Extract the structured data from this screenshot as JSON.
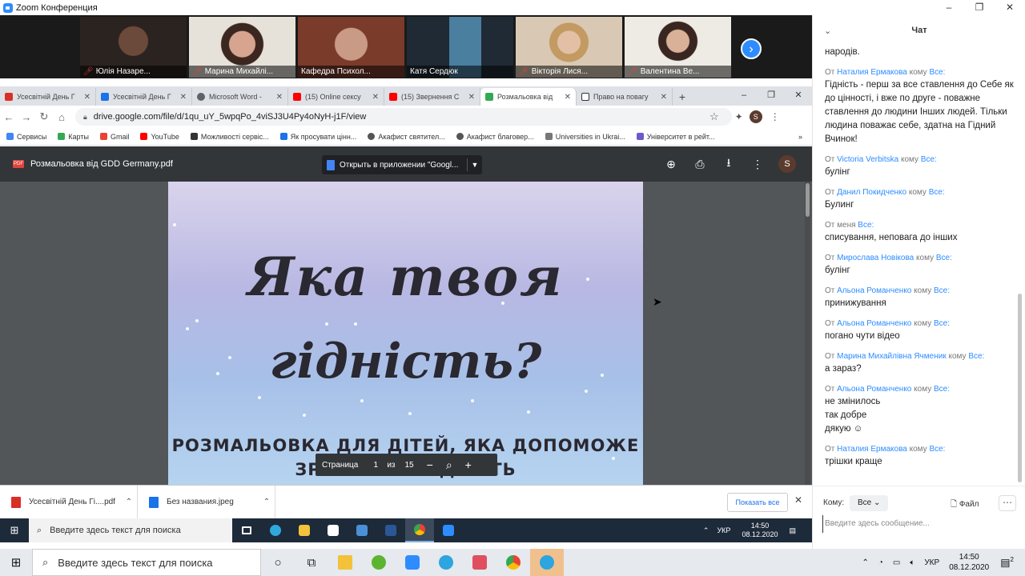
{
  "zoom": {
    "title": "Zoom Конференция",
    "window_buttons": [
      "–",
      "❐",
      "✕"
    ]
  },
  "gallery": {
    "participants": [
      {
        "name": "Юлія Назаре...",
        "muted": true
      },
      {
        "name": "Марина Михайлі...",
        "muted": true,
        "active": true
      },
      {
        "name": "Кафедра Психол...",
        "muted": false
      },
      {
        "name": "Катя Сердюк",
        "muted": false
      },
      {
        "name": "Вікторія Лися...",
        "muted": true
      },
      {
        "name": "Валентина Ве...",
        "muted": true
      }
    ],
    "next_icon": "›"
  },
  "browser": {
    "tabs": [
      {
        "label": "Усесвітній День Г",
        "color": "#d93025"
      },
      {
        "label": "Усесвітній День Г",
        "color": "#1a73e8"
      },
      {
        "label": "Microsoft Word -",
        "color": "#5f6368"
      },
      {
        "label": "(15) Online сексу",
        "color": "#ff0000"
      },
      {
        "label": "(15) Звернення С",
        "color": "#ff0000"
      },
      {
        "label": "Розмальовка від",
        "color": "#34a853",
        "active": true
      },
      {
        "label": "Право на повагу",
        "color": "#333333"
      }
    ],
    "new_tab": "+",
    "window_buttons": [
      "–",
      "❐",
      "✕"
    ],
    "url": "drive.google.com/file/d/1qu_uY_5wpqPo_4viSJ3U4Py4oNyH-j1F/view",
    "profile_letter": "S",
    "bookmarks": [
      {
        "label": "Сервисы",
        "color": "#4285f4"
      },
      {
        "label": "Карты",
        "color": "#34a853"
      },
      {
        "label": "Gmail",
        "color": "#ea4335"
      },
      {
        "label": "YouTube",
        "color": "#ff0000"
      },
      {
        "label": "Можливості сервіс...",
        "color": "#333333"
      },
      {
        "label": "Як просувати цінн...",
        "color": "#1a73e8"
      },
      {
        "label": "Акафист святител...",
        "color": "#555555"
      },
      {
        "label": "Акафист благовер...",
        "color": "#555555"
      },
      {
        "label": "Universities in Ukrai...",
        "color": "#777777"
      },
      {
        "label": "Університет в рейт...",
        "color": "#6a5acd"
      }
    ],
    "bookmarks_more": "»"
  },
  "pdf": {
    "badge": "PDF",
    "filename": "Розмальовка від GDD Germany.pdf",
    "open_with": "Открыть в приложении \"Googl...",
    "avatar": "S",
    "page_title_line1": "Яка твоя",
    "page_title_line2": "гідність?",
    "page_subtitle_line1": "РОЗМАЛЬОВКА ДЛЯ ДІТЕЙ, ЯКА ДОПОМОЖЕ",
    "page_subtitle_line2": "ЗРОЗУМІТИ ГІДНІСТЬ",
    "pager_label": "Страница",
    "current_page": "1",
    "of_label": "из",
    "total_pages": "15"
  },
  "downloads": {
    "items": [
      {
        "label": "Усесвітній День Гі....pdf",
        "color": "#d93025"
      },
      {
        "label": "Без названия.jpeg",
        "color": "#1a73e8"
      }
    ],
    "show_all": "Показать все"
  },
  "inner_taskbar": {
    "search_placeholder": "Введите здесь текст для поиска",
    "lang": "УКР",
    "time": "14:50",
    "date": "08.12.2020"
  },
  "outer_taskbar": {
    "search_placeholder": "Введите здесь текст для поиска",
    "lang": "УКР",
    "time": "14:50",
    "date": "08.12.2020",
    "notif_count": "2"
  },
  "chat": {
    "title": "Чат",
    "messages": [
      {
        "from": "",
        "to": "",
        "lines": [
          "народів."
        ]
      },
      {
        "from": "Наталия Ермакова",
        "to": "Все:",
        "lines": [
          "Гідність - перш за все ставлення до Себе як до цінності, і вже по друге - поважне ставлення до людини Інших людей. Тільки людина поважає себе, здатна на Гідний Вчинок!"
        ]
      },
      {
        "from": "Victoria Verbitska",
        "to": "Все:",
        "lines": [
          "булінг"
        ]
      },
      {
        "from": "Данил Покидченко",
        "to": "Все:",
        "lines": [
          "Булинг"
        ]
      },
      {
        "from": "меня",
        "to": "Все:",
        "self": true,
        "lines": [
          "списування, неповага до інших"
        ]
      },
      {
        "from": "Мирослава Новікова",
        "to": "Все:",
        "lines": [
          "булінг"
        ]
      },
      {
        "from": "Альона Романченко",
        "to": "Все:",
        "lines": [
          "принижування"
        ]
      },
      {
        "from": "Альона Романченко",
        "to": "Все:",
        "lines": [
          "погано чути відео"
        ]
      },
      {
        "from": "Марина Михайлівна Ячменик",
        "to": "Все:",
        "lines": [
          "а зараз?"
        ]
      },
      {
        "from": "Альона Романченко",
        "to": "Все:",
        "lines": [
          "не змінилось",
          "так добре",
          "дякую ☺"
        ]
      },
      {
        "from": "Наталия Ермакова",
        "to": "Все:",
        "lines": [
          "трішки краще"
        ]
      }
    ],
    "from_prefix": "От",
    "to_prefix": "кому",
    "to_label": "Кому:",
    "recipient": "Все",
    "file_label": "Файл",
    "input_placeholder": "Введите здесь сообщение..."
  }
}
